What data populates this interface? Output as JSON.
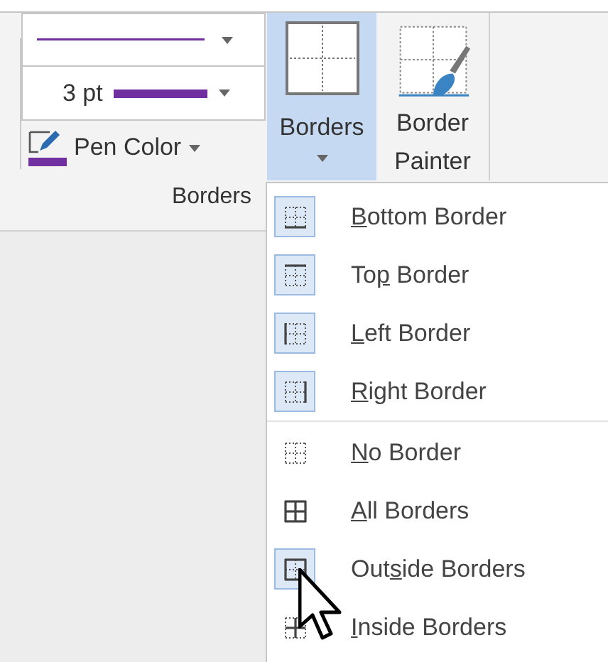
{
  "ribbon": {
    "line_weight": "3 pt",
    "pen_color": "Pen Color",
    "borders_button": {
      "label": "Borders",
      "selected": true
    },
    "border_painter": "Border Painter",
    "group_label": "Borders"
  },
  "menu": {
    "sections": [
      {
        "items": [
          {
            "kind": "bottom",
            "key": "B",
            "after": "ottom Border",
            "highlighted": true
          },
          {
            "kind": "top",
            "before": "To",
            "key": "p",
            "after": " Border",
            "highlighted": true
          },
          {
            "kind": "left",
            "key": "L",
            "after": "eft Border",
            "highlighted": true
          },
          {
            "kind": "right",
            "key": "R",
            "after": "ight Border",
            "highlighted": true
          }
        ]
      },
      {
        "items": [
          {
            "kind": "none",
            "key": "N",
            "after": "o Border",
            "highlighted": false
          },
          {
            "kind": "all",
            "key": "A",
            "after": "ll Borders",
            "highlighted": false
          },
          {
            "kind": "outside",
            "before": "Out",
            "key": "s",
            "after": "ide Borders",
            "highlighted": true
          },
          {
            "kind": "inside",
            "key": "I",
            "after": "nside Borders",
            "highlighted": false
          }
        ]
      }
    ]
  }
}
